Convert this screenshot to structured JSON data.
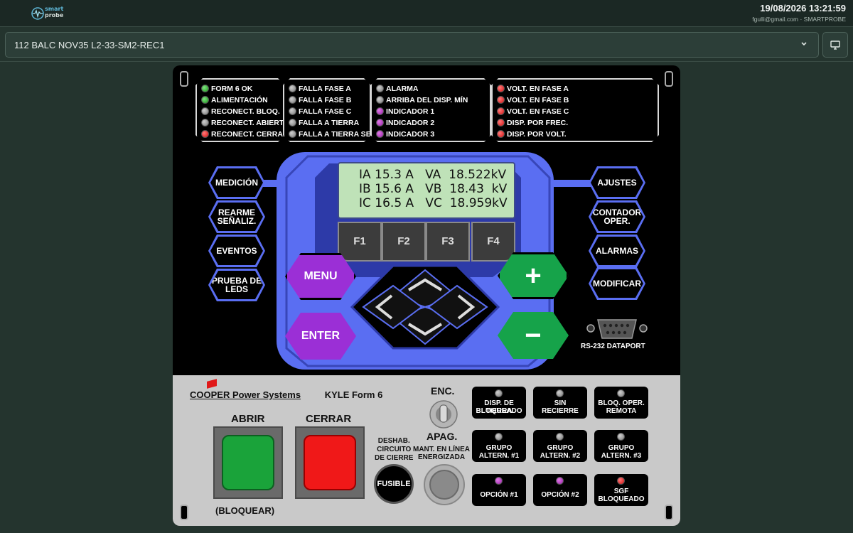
{
  "header": {
    "logo_line1": "smart",
    "logo_line2": "probe",
    "datetime": "19/08/2026 13:21:59",
    "user": "fgulli@gmail.com · SMARTPROBE"
  },
  "selector": {
    "value": "112 BALC NOV35 L2-33-SM2-REC1"
  },
  "led_groups": [
    {
      "items": [
        {
          "label": "FORM 6 OK",
          "color": "green"
        },
        {
          "label": "ALIMENTACIÓN",
          "color": "green"
        },
        {
          "label": "RECONECT. BLOQ.",
          "color": "gray"
        },
        {
          "label": "RECONECT. ABIERTO",
          "color": "gray"
        },
        {
          "label": "RECONECT. CERRADO",
          "color": "red"
        }
      ]
    },
    {
      "items": [
        {
          "label": "FALLA FASE A",
          "color": "gray"
        },
        {
          "label": "FALLA FASE B",
          "color": "gray"
        },
        {
          "label": "FALLA FASE C",
          "color": "gray"
        },
        {
          "label": "FALLA A TIERRA",
          "color": "gray"
        },
        {
          "label": "FALLA A TIERRA SEN",
          "color": "gray"
        }
      ]
    },
    {
      "items": [
        {
          "label": "ALARMA",
          "color": "gray"
        },
        {
          "label": "ARRIBA DEL DISP. MÍN",
          "color": "gray"
        },
        {
          "label": "INDICADOR 1",
          "color": "purple"
        },
        {
          "label": "INDICADOR 2",
          "color": "purple"
        },
        {
          "label": "INDICADOR 3",
          "color": "purple"
        }
      ]
    },
    {
      "items": [
        {
          "label": "VOLT. EN FASE A",
          "color": "red"
        },
        {
          "label": "VOLT. EN FASE B",
          "color": "red"
        },
        {
          "label": "VOLT. EN FASE C",
          "color": "red"
        },
        {
          "label": "DISP. POR FREC.",
          "color": "red"
        },
        {
          "label": "DISP. POR VOLT.",
          "color": "red"
        }
      ]
    }
  ],
  "lcd": {
    "line1": "IA 15.3 A   VA  18.522kV",
    "line2": "IB 15.6 A   VB  18.43  kV",
    "line3": "IC 16.5 A   VC  18.959kV"
  },
  "fkeys": [
    "F1",
    "F2",
    "F3",
    "F4"
  ],
  "left_buttons": {
    "medicion": "MEDICIÓN",
    "rearme_1": "REARME",
    "rearme_2": "SEÑALIZ.",
    "eventos": "EVENTOS",
    "prueba_1": "PRUEBA DE",
    "prueba_2": "LEDS"
  },
  "right_buttons": {
    "ajustes": "AJUSTES",
    "contador_1": "CONTADOR",
    "contador_2": "OPER.",
    "alarmas": "ALARMAS",
    "modificar": "MODIFICAR"
  },
  "keypad": {
    "menu": "MENU",
    "enter": "ENTER",
    "plus": "+",
    "minus": "−"
  },
  "connector_label": "RS-232 DATAPORT",
  "lower": {
    "brand": "COOPER Power Systems",
    "model": "KYLE Form 6",
    "abrir": "ABRIR",
    "cerrar": "CERRAR",
    "bloquear": "(BLOQUEAR)",
    "enc": "ENC.",
    "apag": "APAG.",
    "deshab_1": "DESHAB.",
    "deshab_2": "CIRCUITO",
    "deshab_3": "DE CIERRE",
    "fusible": "FUSIBLE",
    "mant_1": "MANT. EN LÍNEA",
    "mant_2": "ENERGIZADA"
  },
  "status_buttons": [
    {
      "line1": "DISP. DE TIERRA",
      "line2": "BLOQUEADO",
      "led": "gray"
    },
    {
      "line1": "SIN",
      "line2": "RECIERRE",
      "led": "gray"
    },
    {
      "line1": "BLOQ. OPER.",
      "line2": "REMOTA",
      "led": "gray"
    },
    {
      "line1": "GRUPO",
      "line2": "ALTERN. #1",
      "led": "gray"
    },
    {
      "line1": "GRUPO",
      "line2": "ALTERN. #2",
      "led": "gray"
    },
    {
      "line1": "GRUPO",
      "line2": "ALTERN. #3",
      "led": "gray"
    },
    {
      "line1": "OPCIÓN #1",
      "line2": "",
      "led": "purple"
    },
    {
      "line1": "OPCIÓN #2",
      "line2": "",
      "led": "purple"
    },
    {
      "line1": "SGF",
      "line2": "BLOQUEADO",
      "led": "red"
    }
  ]
}
